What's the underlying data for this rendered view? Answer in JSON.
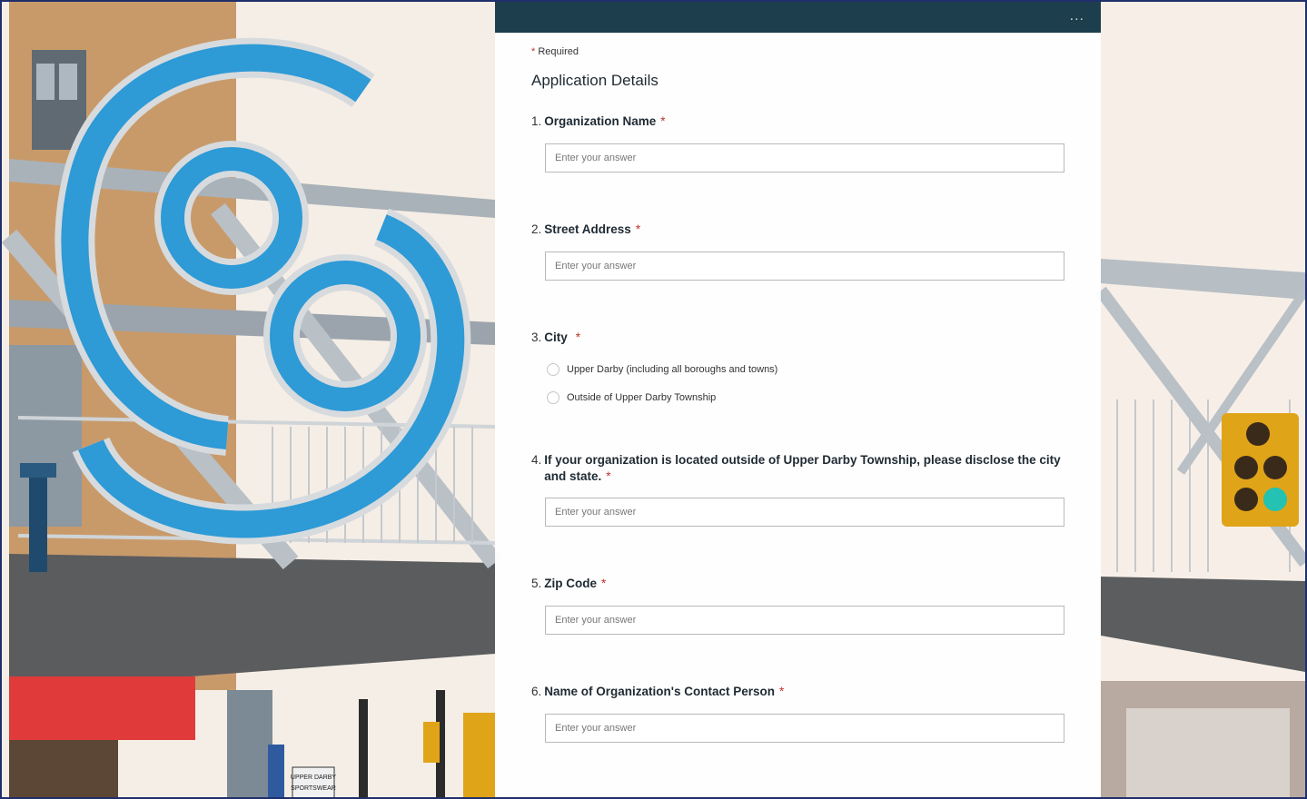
{
  "form": {
    "menu_label": "...",
    "required_note": "Required",
    "required_star": "*",
    "section_title": "Application Details",
    "placeholder": "Enter your answer",
    "questions": [
      {
        "num": "1.",
        "title": "Organization Name",
        "type": "text"
      },
      {
        "num": "2.",
        "title": "Street Address",
        "type": "text"
      },
      {
        "num": "3.",
        "title": "City",
        "type": "choice",
        "options": [
          "Upper Darby (including all boroughs and towns)",
          "Outside of Upper Darby Township"
        ]
      },
      {
        "num": "4.",
        "title": "If your organization is located outside of Upper Darby Township, please disclose the city and state.",
        "type": "text"
      },
      {
        "num": "5.",
        "title": "Zip Code",
        "type": "text"
      },
      {
        "num": "6.",
        "title": "Name of Organization's Contact Person",
        "type": "text"
      }
    ]
  },
  "background": {
    "sign_text_1": "UPPER DARBY",
    "sign_text_2": "SPORTSWEAR",
    "accent_blue": "#2e9ad6",
    "header_color": "#1d3e4c",
    "star_color": "#c4312b"
  }
}
